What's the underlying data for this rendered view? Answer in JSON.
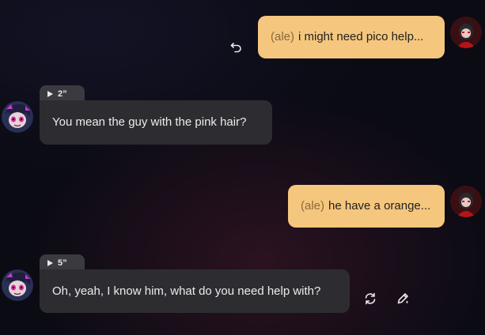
{
  "messages": [
    {
      "role": "user",
      "prefix": "(ale)",
      "text": "i might need pico help..."
    },
    {
      "role": "ai",
      "duration": "2”",
      "text": "You mean the guy with the pink hair?"
    },
    {
      "role": "user",
      "prefix": "(ale)",
      "text": "he have a orange..."
    },
    {
      "role": "ai",
      "duration": "5”",
      "text": "Oh, yeah, I know him, what do you need help with?"
    }
  ],
  "icons": {
    "undo": "undo-icon",
    "regenerate": "regenerate-icon",
    "edit": "edit-icon",
    "play": "play-icon"
  },
  "colors": {
    "user_bubble": "#f5c67d",
    "ai_bubble": "#2d2d31",
    "background": "#0b0b14"
  }
}
